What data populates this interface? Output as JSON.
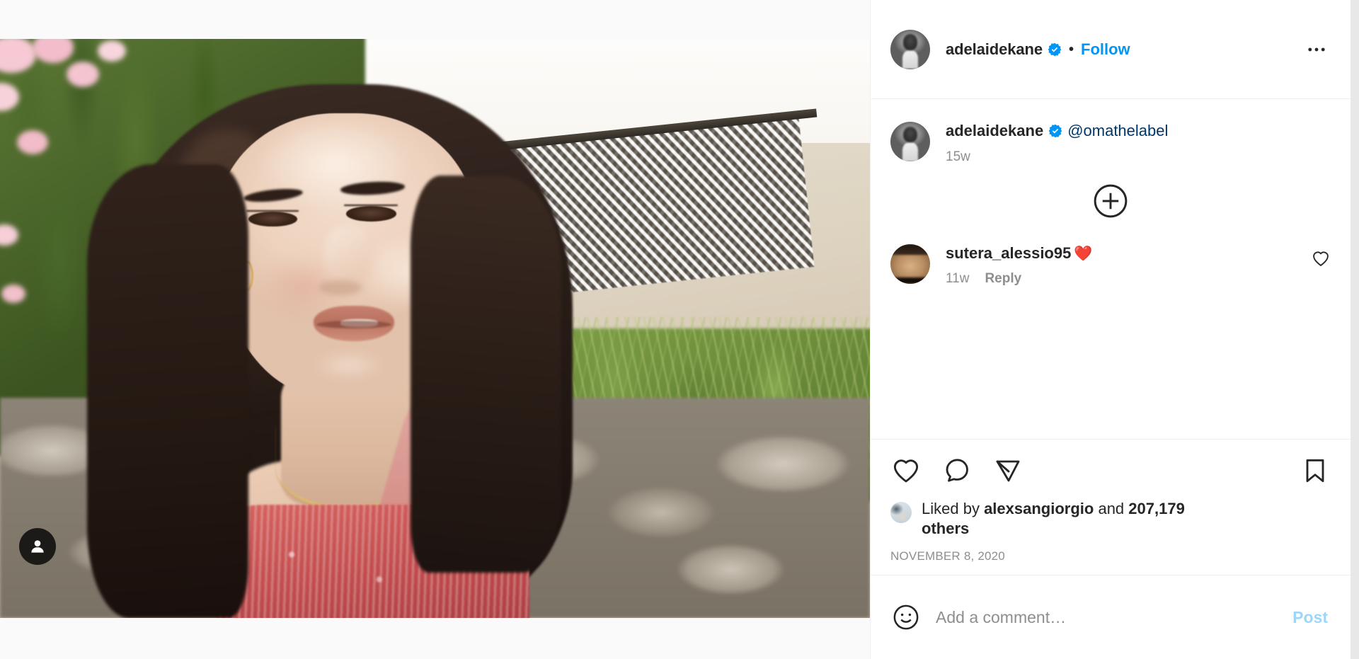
{
  "header": {
    "username": "adelaidekane",
    "verified_icon": "verified-badge-icon",
    "separator": "•",
    "follow_label": "Follow",
    "more_icon": "ellipsis-icon",
    "avatar_alt": "adelaidekane-avatar"
  },
  "caption": {
    "username": "adelaidekane",
    "verified_icon": "verified-badge-icon",
    "text": "@omathelabel",
    "time": "15w"
  },
  "load_more": {
    "icon": "plus-circle-icon",
    "label": "Load more comments"
  },
  "comments": [
    {
      "username": "sutera_alessio95",
      "text": "❤️",
      "time": "11w",
      "reply_label": "Reply",
      "like_icon": "heart-outline-icon",
      "avatar_alt": "sutera_alessio95-avatar"
    }
  ],
  "actions": {
    "like_icon": "heart-icon",
    "comment_icon": "comment-bubble-icon",
    "share_icon": "share-paper-plane-icon",
    "save_icon": "bookmark-icon"
  },
  "likes": {
    "prefix": "Liked by ",
    "username": "alexsangiorgio",
    "middle": " and ",
    "count_text": "207,179 others",
    "avatar_alt": "alexsangiorgio-avatar"
  },
  "post_date": "NOVEMBER 8, 2020",
  "compose": {
    "emoji_icon": "smiley-face-icon",
    "placeholder": "Add a comment…",
    "value": "",
    "post_label": "Post"
  },
  "media": {
    "tag_badge_icon": "person-tag-icon",
    "alt": "Woman with long dark hair in a red patterned top outdoors"
  },
  "colors": {
    "accent": "#0095f6",
    "link_dark": "#00376b",
    "text": "#262626",
    "muted": "#8e8e8e",
    "border": "#efefef"
  }
}
